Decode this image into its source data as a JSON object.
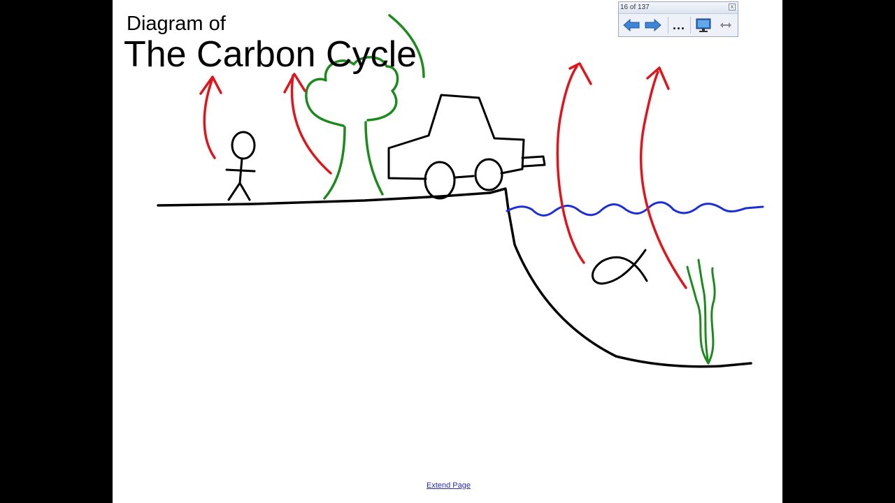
{
  "title": {
    "line1": "Diagram of",
    "line2": "The Carbon Cycle"
  },
  "navigator": {
    "page_indicator": "16 of 137",
    "close_symbol": "x",
    "prev_icon": "left-arrow-icon",
    "next_icon": "right-arrow-icon",
    "more_label": "...",
    "display_icon": "monitor-icon",
    "resize_icon": "horizontal-resize-icon"
  },
  "footer": {
    "extend_link": "Extend Page"
  },
  "colors": {
    "ink": "#000000",
    "arrow": "#e0151b",
    "plant": "#1d8a1d",
    "water": "#1c2fd6",
    "link": "#2a2aa8"
  }
}
